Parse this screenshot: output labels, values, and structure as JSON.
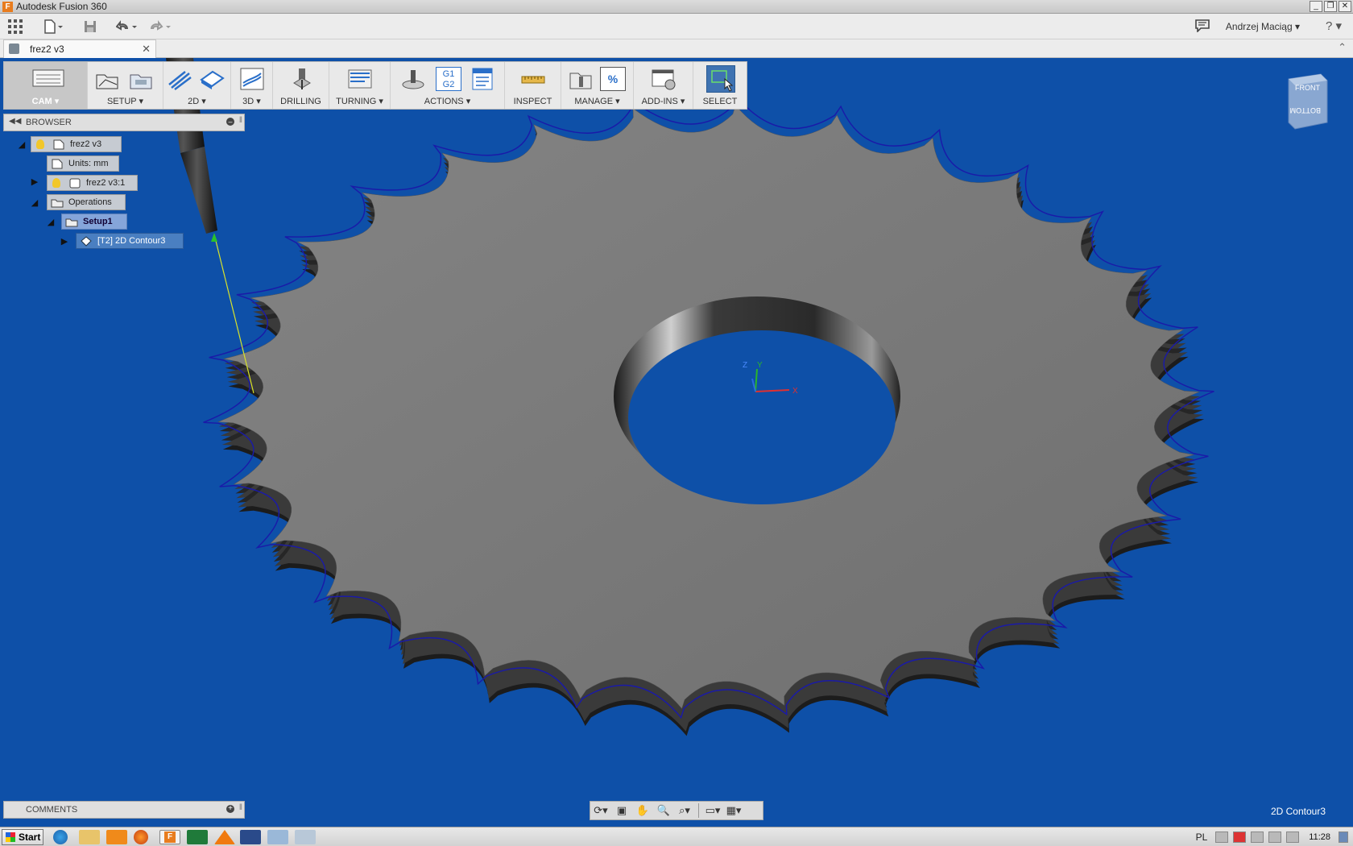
{
  "window": {
    "title": "Autodesk Fusion 360"
  },
  "quick_access": {
    "user_name": "Andrzej Maciąg",
    "help_symbol": "?"
  },
  "document_tab": {
    "label": "frez2 v3",
    "close_symbol": "✕"
  },
  "ribbon": {
    "workspace_label": "CAM",
    "groups": [
      {
        "id": "setup",
        "label": "SETUP"
      },
      {
        "id": "2d",
        "label": "2D"
      },
      {
        "id": "3d",
        "label": "3D"
      },
      {
        "id": "drilling",
        "label": "DRILLING"
      },
      {
        "id": "turning",
        "label": "TURNING"
      },
      {
        "id": "actions",
        "label": "ACTIONS",
        "icon_text": "G1 G2"
      },
      {
        "id": "inspect",
        "label": "INSPECT"
      },
      {
        "id": "manage",
        "label": "MANAGE",
        "icon_text": "%"
      },
      {
        "id": "addins",
        "label": "ADD-INS"
      },
      {
        "id": "select",
        "label": "SELECT"
      }
    ]
  },
  "browser": {
    "title": "BROWSER",
    "nodes": [
      {
        "label": "frez2 v3"
      },
      {
        "label": "Units: mm"
      },
      {
        "label": "frez2 v3:1"
      },
      {
        "label": "Operations"
      },
      {
        "label": "Setup1"
      },
      {
        "label": "[T2] 2D Contour3"
      }
    ]
  },
  "viewcube": {
    "front": "FRONT",
    "bottom": "BOTTOM"
  },
  "triad": {
    "x": "X",
    "y": "Y",
    "z": "Z"
  },
  "comments": {
    "title": "COMMENTS"
  },
  "status": {
    "active_operation": "2D Contour3"
  },
  "taskbar": {
    "start_label": "Start",
    "language": "PL",
    "clock": "11:28"
  },
  "colors": {
    "viewport_bg": "#0e50a8",
    "part_face": "#7a7a7a",
    "toolpath": "#1a1aa8",
    "lead_in": "#d8e22a"
  },
  "icons": [
    "app-icon",
    "grid-menu-icon",
    "file-icon",
    "save-icon",
    "undo-icon",
    "redo-icon",
    "comment-icon",
    "help-icon",
    "part-icon",
    "bulb-icon",
    "setup-icon",
    "operation-icon",
    "orbit-icon",
    "pan-icon",
    "zoom-icon",
    "display-icon",
    "grid-icon"
  ]
}
